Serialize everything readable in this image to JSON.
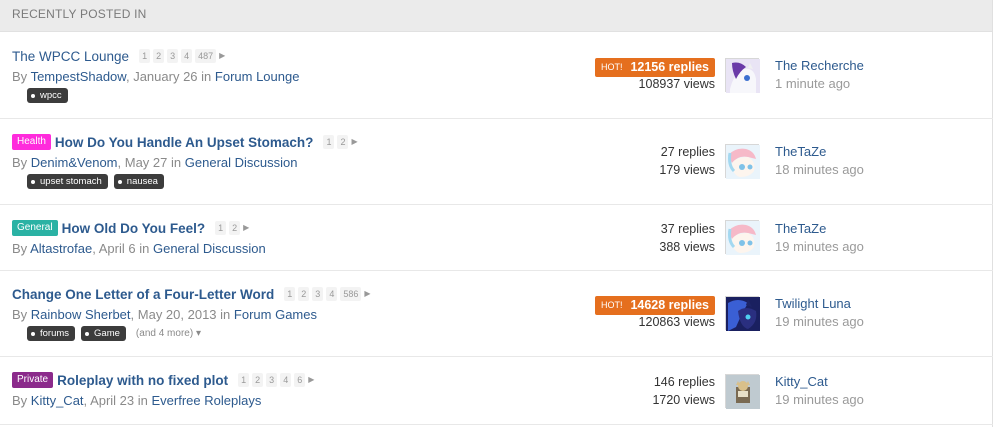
{
  "header": {
    "title": "RECENTLY POSTED IN"
  },
  "colors": {
    "link": "#2d5a8e",
    "hot": "#e56f1e",
    "health": "#ff2bdc",
    "general": "#2ab2a4",
    "private": "#8b2a8b"
  },
  "topics": [
    {
      "prefix": "",
      "title": "The WPCC Lounge",
      "bold": false,
      "pages": [
        "1",
        "2",
        "3",
        "4",
        "487"
      ],
      "author": "TempestShadow",
      "date": "January 26",
      "in_label": "in",
      "forum": "Forum Lounge",
      "tags": [
        "wpcc"
      ],
      "more": "",
      "hot": true,
      "hot_label": "HOT!",
      "replies": "12156 replies",
      "views": "108937 views",
      "last_user": "The Recherche",
      "last_time": "1 minute ago",
      "avatar_icon": "pony-avatar-white-purple"
    },
    {
      "prefix": "Health",
      "prefix_color": "#ff2bdc",
      "title": "How Do You Handle An Upset Stomach?",
      "bold": true,
      "pages": [
        "1",
        "2"
      ],
      "author": "Denim&Venom",
      "date": "May 27",
      "in_label": "in",
      "forum": "General Discussion",
      "tags": [
        "upset stomach",
        "nausea"
      ],
      "more": "",
      "hot": false,
      "replies": "27 replies",
      "views": "179 views",
      "last_user": "TheTaZe",
      "last_time": "18 minutes ago",
      "avatar_icon": "pony-avatar-pastel"
    },
    {
      "prefix": "General",
      "prefix_color": "#2ab2a4",
      "title": "How Old Do You Feel?",
      "bold": true,
      "pages": [
        "1",
        "2"
      ],
      "author": "Altastrofae",
      "date": "April 6",
      "in_label": "in",
      "forum": "General Discussion",
      "tags": [],
      "more": "",
      "hot": false,
      "replies": "37 replies",
      "views": "388 views",
      "last_user": "TheTaZe",
      "last_time": "19 minutes ago",
      "avatar_icon": "pony-avatar-pastel"
    },
    {
      "prefix": "",
      "title": "Change One Letter of a Four-Letter Word",
      "bold": true,
      "pages": [
        "1",
        "2",
        "3",
        "4",
        "586"
      ],
      "author": "Rainbow Sherbet",
      "date": "May 20, 2013",
      "in_label": "in",
      "forum": "Forum Games",
      "tags": [
        "forums",
        "Game"
      ],
      "more": "(and 4 more)",
      "hot": true,
      "hot_label": "HOT!",
      "replies": "14628 replies",
      "views": "120863 views",
      "last_user": "Twilight Luna",
      "last_time": "19 minutes ago",
      "avatar_icon": "pony-avatar-luna"
    },
    {
      "prefix": "Private",
      "prefix_color": "#8b2a8b",
      "title": "Roleplay with no fixed plot",
      "bold": true,
      "pages": [
        "1",
        "2",
        "3",
        "4",
        "6"
      ],
      "author": "Kitty_Cat",
      "date": "April 23",
      "in_label": "in",
      "forum": "Everfree Roleplays",
      "tags": [],
      "more": "",
      "hot": false,
      "replies": "146 replies",
      "views": "1720 views",
      "last_user": "Kitty_Cat",
      "last_time": "19 minutes ago",
      "avatar_icon": "cat-avatar"
    }
  ]
}
